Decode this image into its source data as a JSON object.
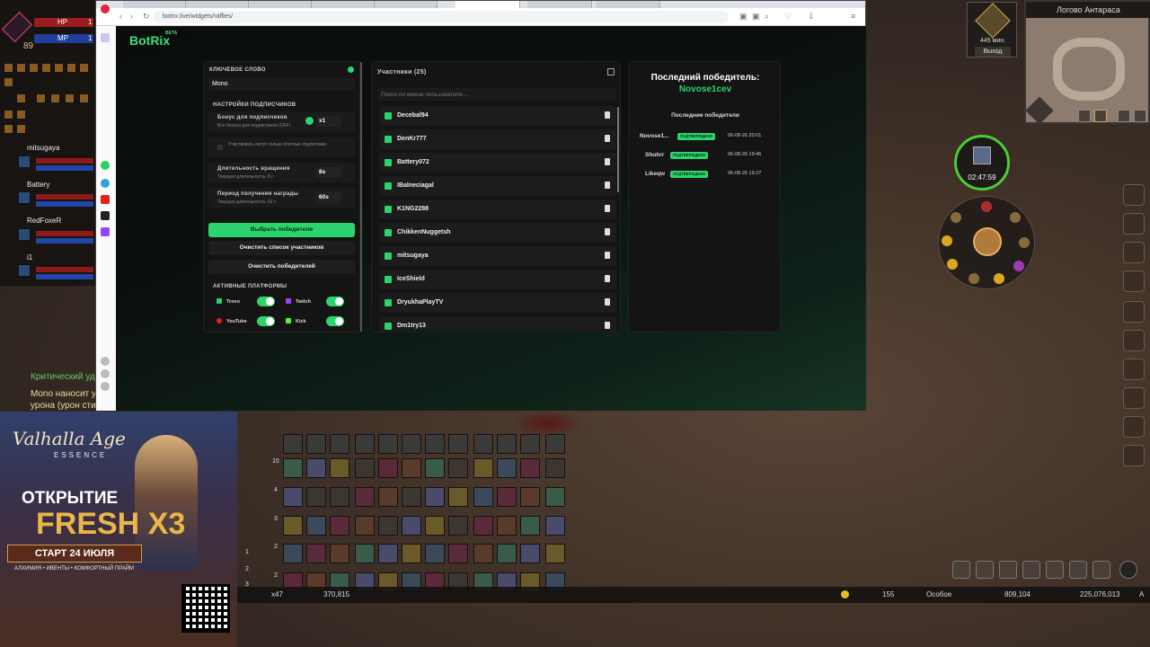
{
  "game": {
    "player": {
      "hp_label": "HP",
      "mp_label": "MP",
      "level": "89",
      "hp_num": "1",
      "mp_num": "1"
    },
    "party": [
      {
        "name": "mitsugaya"
      },
      {
        "name": "Battery"
      },
      {
        "name": "RedFoxeR"
      },
      {
        "name": "i1"
      }
    ],
    "chat": [
      "Критический уд",
      "Mono наносит у",
      "урона (урон сти"
    ],
    "minimap_title": "Логово Антараса",
    "boss_timer": "445 мин.",
    "exit_label": "Выход",
    "event_timer": "02:47:59",
    "status": {
      "count": "x47",
      "adena": "370,815",
      "val155": "155",
      "mode": "Особое",
      "gold": "809,104",
      "exp": "225,076,013",
      "last": "A"
    },
    "hotbar_rows": [
      "10",
      "4",
      "3",
      "2",
      "2"
    ],
    "hotbar_pages": [
      "1",
      "2",
      "3"
    ]
  },
  "ad": {
    "logo": "Valhalla Age",
    "logo_sub": "ESSENCE",
    "open": "ОТКРЫТИЕ",
    "fresh": "FRESH X3",
    "start": "СТАРТ 24 ИЮЛЯ",
    "tags": "АЛХИМИЯ • ИВЕНТЫ • КОМФОРТНЫЙ ПРАЙМ"
  },
  "browser": {
    "url": "botrix.live/widgets/raffles/"
  },
  "page": {
    "brand": "BotRix",
    "brand_beta": "BETA",
    "left": {
      "keyword_label": "КЛЮЧЕВОЕ СЛОВО",
      "keyword_value": "Mono",
      "sub_settings": "НАСТРОЙКИ ПОДПИСЧИКОВ",
      "bonus_title": "Бонус для подписчиков",
      "bonus_sub": "Все бонуса для подписчиков (OFF)",
      "bonus_value": "x1",
      "paid_only": "Участвовать могут только платные подписчики",
      "spin_title": "Длительность вращения",
      "spin_sub": "Текущая длительность: 8 с",
      "spin_value": "8s",
      "period_title": "Период получения награды",
      "period_sub": "Текущая длительность: 60 с",
      "period_value": "60s",
      "btn_pick": "Выбрать победителя",
      "btn_clear_participants": "Очистить список участников",
      "btn_clear_winners": "Очистить победителей",
      "platforms_label": "АКТИВНЫЕ ПЛАТФОРМЫ",
      "platforms": [
        {
          "name": "Trovo"
        },
        {
          "name": "Twitch"
        },
        {
          "name": "YouTube"
        },
        {
          "name": "Kick"
        }
      ]
    },
    "participants": {
      "title": "Участники (25)",
      "search_placeholder": "Поиск по имени пользователя...",
      "list": [
        "Decebal94",
        "DenKr777",
        "Battery072",
        "IBalneciagal",
        "K1NG2288",
        "ChikkenNuggetsh",
        "mitsugaya",
        "IceShield",
        "DryukhaPlayTV",
        "Dm1try13"
      ]
    },
    "winner": {
      "title": "Последний победитель:",
      "name": "Novose1cev",
      "recent_title": "Последние победители",
      "recent": [
        {
          "name": "Novose1...",
          "status": "ПОДТВЕРЖДЕНО",
          "date": "06-08-26 20:01"
        },
        {
          "name": "Shuhrr",
          "status": "ПОДТВЕРЖДЕНО",
          "date": "06-08-26 19:46"
        },
        {
          "name": "Likeqw",
          "status": "ПОДТВЕРЖДЕНО",
          "date": "06-08-26 19:27"
        }
      ]
    }
  }
}
